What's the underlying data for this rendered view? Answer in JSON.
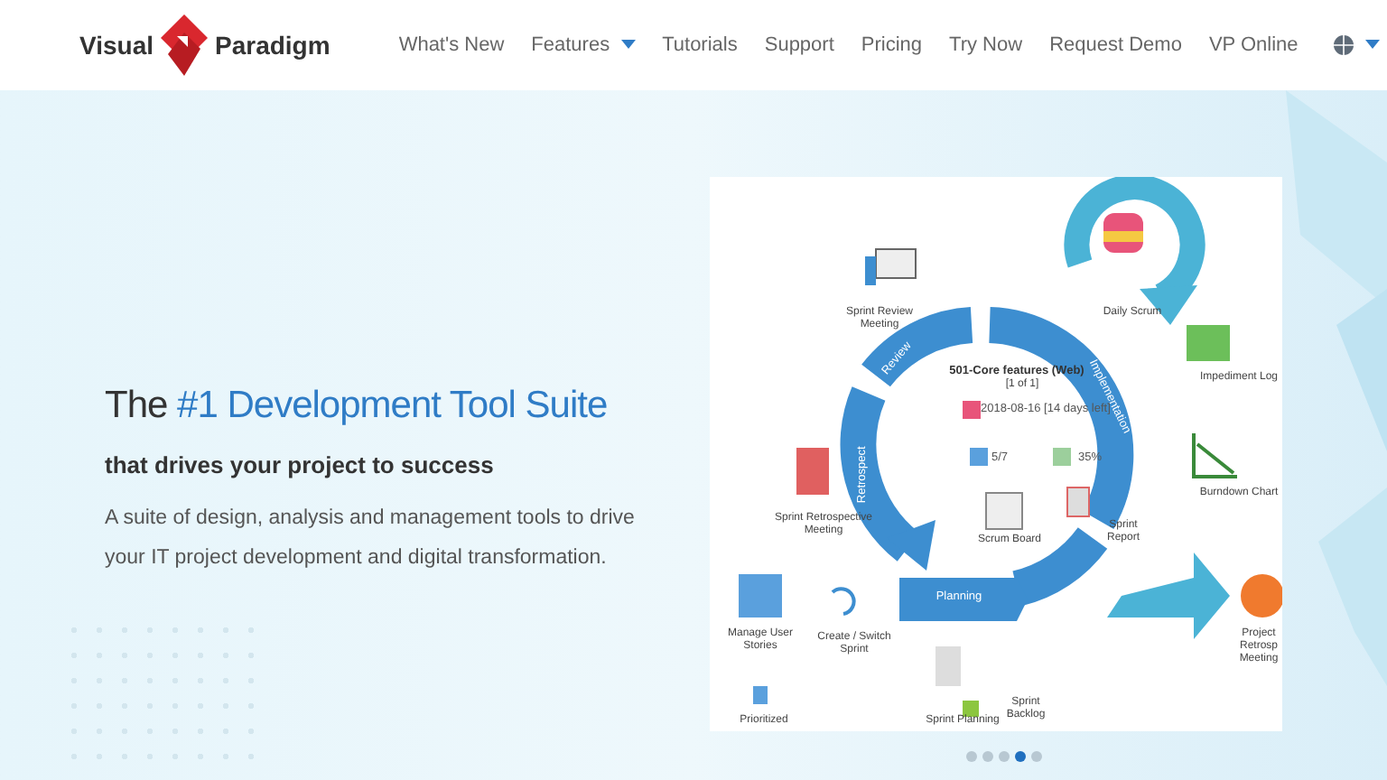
{
  "nav": {
    "logo": {
      "left": "Visual",
      "right": "Paradigm"
    },
    "links": [
      {
        "label": "What's New",
        "dropdown": false
      },
      {
        "label": "Features",
        "dropdown": true
      },
      {
        "label": "Tutorials",
        "dropdown": false
      },
      {
        "label": "Support",
        "dropdown": false
      },
      {
        "label": "Pricing",
        "dropdown": false
      },
      {
        "label": "Try Now",
        "dropdown": false
      },
      {
        "label": "Request Demo",
        "dropdown": false
      },
      {
        "label": "VP Online",
        "dropdown": false
      }
    ],
    "language_menu": {
      "dropdown": true
    }
  },
  "hero": {
    "title_prefix": "The",
    "title_highlight": "#1 Development Tool Suite",
    "subtitle": "that drives your project to success",
    "description": "A suite of design, analysis and management tools to drive your IT project development and digital transformation."
  },
  "diagram": {
    "labels": [
      {
        "kind": "caption",
        "text": "Daily Scrum"
      },
      {
        "kind": "caption",
        "text": "Sprint Review Meeting"
      },
      {
        "kind": "arc",
        "text": "Review"
      },
      {
        "kind": "arc",
        "text": "Implementation"
      },
      {
        "kind": "caption",
        "text": "Impediment Log"
      },
      {
        "kind": "heading",
        "text": "501-Core features (Web)"
      },
      {
        "kind": "caption",
        "text": "[1 of 1]"
      },
      {
        "kind": "info",
        "text": "2018-08-16 [14 days left]"
      },
      {
        "kind": "info",
        "text": "5/7"
      },
      {
        "kind": "info",
        "text": "35%"
      },
      {
        "kind": "arc",
        "text": "Retrospect"
      },
      {
        "kind": "caption",
        "text": "Burndown Chart"
      },
      {
        "kind": "caption",
        "text": "Sprint Retrospective Meeting"
      },
      {
        "kind": "caption",
        "text": "Scrum Board"
      },
      {
        "kind": "caption",
        "text": "Sprint Report"
      },
      {
        "kind": "arc",
        "text": "Planning"
      },
      {
        "kind": "caption",
        "text": "Manage User Stories"
      },
      {
        "kind": "caption",
        "text": "Create / Switch Sprint"
      },
      {
        "kind": "caption",
        "text": "Project Retrosp Meeting"
      },
      {
        "kind": "caption",
        "text": "Prioritized"
      },
      {
        "kind": "caption",
        "text": "Sprint Planning"
      },
      {
        "kind": "caption",
        "text": "Sprint Backlog"
      }
    ]
  },
  "carousel": {
    "dots": [
      {
        "selected": false
      },
      {
        "selected": false
      },
      {
        "selected": false
      },
      {
        "selected": true
      },
      {
        "selected": false
      }
    ]
  }
}
